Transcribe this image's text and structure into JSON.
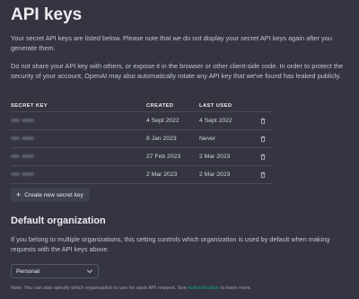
{
  "page": {
    "title": "API keys",
    "intro": "Your secret API keys are listed below. Please note that we do not display your secret API keys again after you generate them.",
    "warning": "Do not share your API key with others, or expose it in the browser or other client-side code. In order to protect the security of your account, OpenAI may also automatically rotate any API key that we've found has leaked publicly."
  },
  "table": {
    "headers": {
      "key": "SECRET KEY",
      "created": "CREATED",
      "last_used": "LAST USED"
    },
    "rows": [
      {
        "created": "4 Sept 2022",
        "last_used": "4 Sept 2022"
      },
      {
        "created": "8 Jan 2023",
        "last_used": "Never"
      },
      {
        "created": "27 Feb 2023",
        "last_used": "2 Mar 2023"
      },
      {
        "created": "2 Mar 2023",
        "last_used": "2 Mar 2023"
      }
    ],
    "row_action_icon": "trash-icon"
  },
  "create_button": {
    "icon": "plus-icon",
    "label": "Create new secret key"
  },
  "default_org": {
    "heading": "Default organization",
    "description": "If you belong to multiple organizations, this setting controls which organization is used by default when making requests with the API keys above.",
    "selected": "Personal",
    "note_prefix": "Note: You can also specify which organization to use for each API request. See ",
    "note_link": "Authentication",
    "note_suffix": " to learn more."
  },
  "colors": {
    "background": "#343541",
    "accent_link": "#10a37f",
    "text": "#d1d5db"
  }
}
